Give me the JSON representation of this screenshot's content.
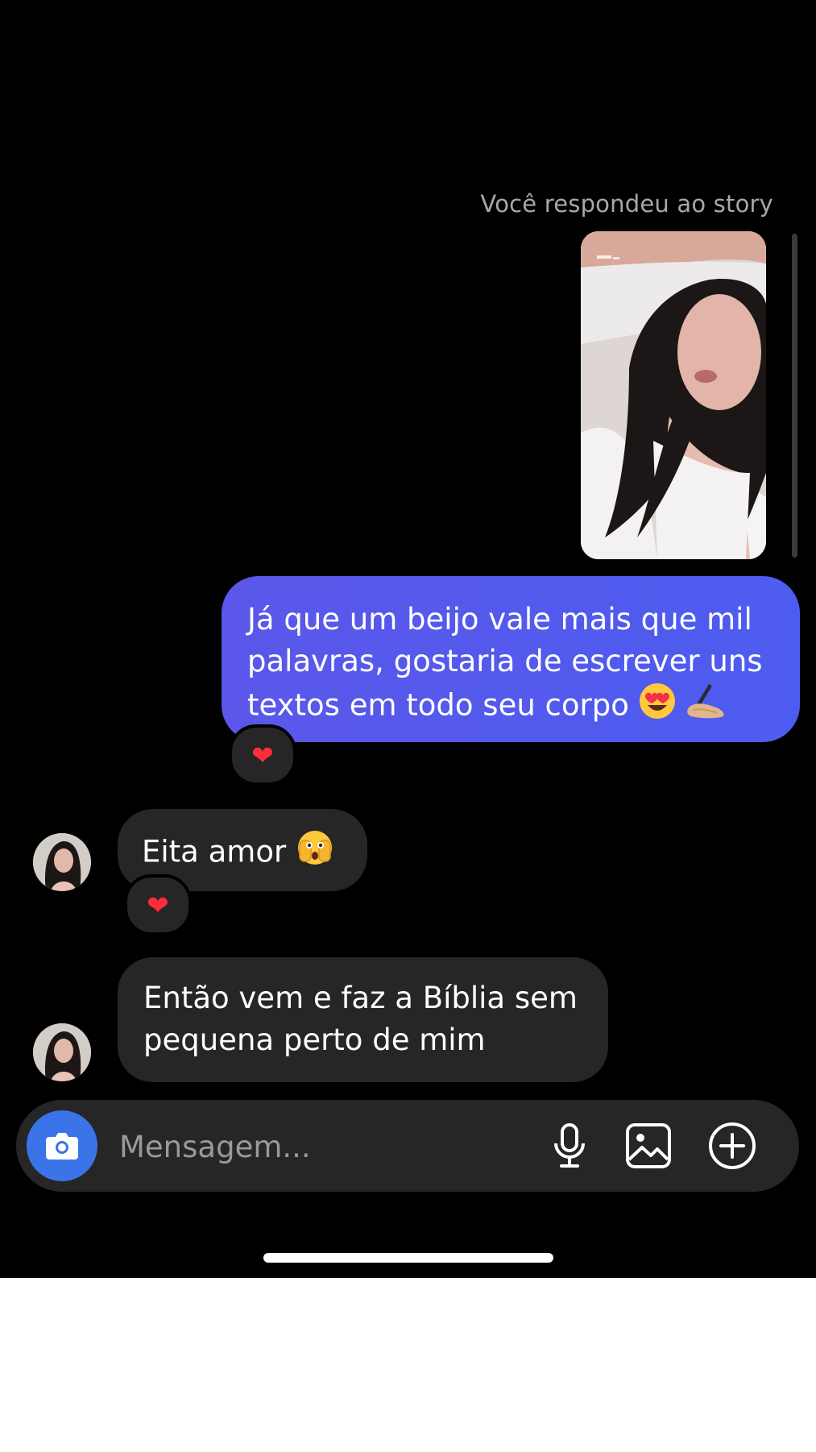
{
  "thread": {
    "story_reply_caption": "Você respondeu ao story",
    "messages": [
      {
        "direction": "outgoing",
        "text": "Já que um beijo vale mais que mil palavras, gostaria de escrever uns textos em todo seu corpo",
        "emojis": [
          "heart-eyes-emoji",
          "writing-hand-emoji"
        ],
        "reaction": "❤"
      },
      {
        "direction": "incoming",
        "text": "Eita amor",
        "emojis": [
          "face-peeking-emoji"
        ],
        "reaction": "❤"
      },
      {
        "direction": "incoming",
        "text_line1": "Então vem e faz a Bíblia sem",
        "text_line2": "pequena perto de mim"
      }
    ]
  },
  "composer": {
    "placeholder": "Mensagem...",
    "icons": [
      "camera-icon",
      "microphone-icon",
      "gallery-icon",
      "plus-icon"
    ]
  },
  "colors": {
    "background": "#000000",
    "outgoing_bubble": "#5158ee",
    "incoming_bubble": "#262626",
    "camera_button": "#3b73e8",
    "reaction_heart": "#ff2d3c"
  }
}
